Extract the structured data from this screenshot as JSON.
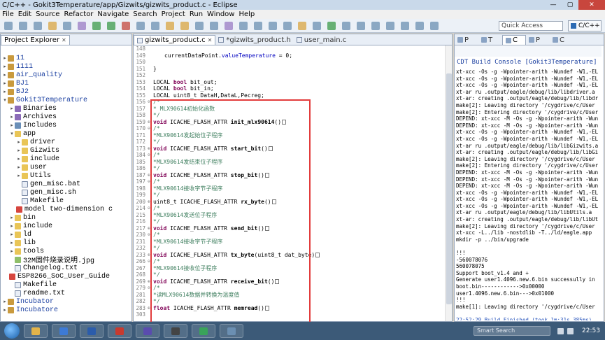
{
  "window": {
    "title": "C/C++ - Gokit3Temperature/app/Gizwits/gizwits_product.c - Eclipse"
  },
  "menu": [
    "File",
    "Edit",
    "Source",
    "Refactor",
    "Navigate",
    "Search",
    "Project",
    "Run",
    "Window",
    "Help"
  ],
  "toolbar": {
    "quick_access_placeholder": "Quick Access",
    "perspective": "C/C++"
  },
  "project_explorer": {
    "tab_label": "Project Explorer",
    "items": [
      {
        "depth": 0,
        "arrow": "▸",
        "icon": "project",
        "label": "11"
      },
      {
        "depth": 0,
        "arrow": "▸",
        "icon": "project",
        "label": "1111"
      },
      {
        "depth": 0,
        "arrow": "▸",
        "icon": "project",
        "label": "air_quality"
      },
      {
        "depth": 0,
        "arrow": "▸",
        "icon": "project",
        "label": "BJ1"
      },
      {
        "depth": 0,
        "arrow": "▸",
        "icon": "project",
        "label": "BJ2"
      },
      {
        "depth": 0,
        "arrow": "▾",
        "icon": "project",
        "label": "Gokit3Temperature"
      },
      {
        "depth": 1,
        "arrow": "▸",
        "icon": "bin",
        "label": "Binaries"
      },
      {
        "depth": 1,
        "arrow": "▸",
        "icon": "bin",
        "label": "Archives"
      },
      {
        "depth": 1,
        "arrow": "▸",
        "icon": "inc",
        "label": "Includes"
      },
      {
        "depth": 1,
        "arrow": "▾",
        "icon": "folder",
        "label": "app"
      },
      {
        "depth": 2,
        "arrow": "▸",
        "icon": "folder",
        "label": "driver"
      },
      {
        "depth": 2,
        "arrow": "▸",
        "icon": "folder",
        "label": "Gizwits"
      },
      {
        "depth": 2,
        "arrow": "▸",
        "icon": "folder",
        "label": "include"
      },
      {
        "depth": 2,
        "arrow": "▸",
        "icon": "folder",
        "label": "user"
      },
      {
        "depth": 2,
        "arrow": "▸",
        "icon": "folder",
        "label": "Utils"
      },
      {
        "depth": 2,
        "arrow": "",
        "icon": "file",
        "label": "gen_misc.bat"
      },
      {
        "depth": 2,
        "arrow": "",
        "icon": "file",
        "label": "gen_misc.sh"
      },
      {
        "depth": 2,
        "arrow": "",
        "icon": "file",
        "label": "Makefile"
      },
      {
        "depth": 2,
        "arrow": "",
        "icon": "pdf",
        "label": "model two-dimension code"
      },
      {
        "depth": 1,
        "arrow": "▸",
        "icon": "folder",
        "label": "bin"
      },
      {
        "depth": 1,
        "arrow": "▸",
        "icon": "folder",
        "label": "include"
      },
      {
        "depth": 1,
        "arrow": "▸",
        "icon": "folder",
        "label": "ld"
      },
      {
        "depth": 1,
        "arrow": "▸",
        "icon": "folder",
        "label": "lib"
      },
      {
        "depth": 1,
        "arrow": "▸",
        "icon": "folder",
        "label": "tools"
      },
      {
        "depth": 1,
        "arrow": "",
        "icon": "image",
        "label": "32M固件烧录说明.jpg"
      },
      {
        "depth": 1,
        "arrow": "",
        "icon": "file",
        "label": "Changelog.txt"
      },
      {
        "depth": 1,
        "arrow": "",
        "icon": "pdf",
        "label": "ESP8266_SoC_User_Guide _V0"
      },
      {
        "depth": 1,
        "arrow": "",
        "icon": "file",
        "label": "Makefile"
      },
      {
        "depth": 1,
        "arrow": "",
        "icon": "file",
        "label": "readme.txt"
      },
      {
        "depth": 0,
        "arrow": "▸",
        "icon": "project",
        "label": "Incubator"
      },
      {
        "depth": 0,
        "arrow": "▸",
        "icon": "project",
        "label": "Incubatore"
      }
    ]
  },
  "editor": {
    "tabs": [
      {
        "label": "gizwits_product.c",
        "active": true
      },
      {
        "label": "*gizwits_product.h",
        "active": false
      },
      {
        "label": "user_main.c",
        "active": false
      }
    ],
    "lines": [
      {
        "n": "148",
        "fold": "",
        "html": "<span style=\"padding-left:16px\"></span>"
      },
      {
        "n": "149",
        "fold": "",
        "html": "<span style=\"padding-left:16px\">currentDataPoint.</span><span class=\"field\">valueTemperature</span> = 0;"
      },
      {
        "n": "150",
        "fold": "",
        "html": ""
      },
      {
        "n": "151",
        "fold": "",
        "html": "}"
      },
      {
        "n": "152",
        "fold": "",
        "html": ""
      },
      {
        "n": "153",
        "fold": "",
        "html": "LOCAL <span class=\"kw\">bool</span> bit_out;"
      },
      {
        "n": "154",
        "fold": "",
        "html": "LOCAL <span class=\"kw\">bool</span> bit_in;"
      },
      {
        "n": "155",
        "fold": "",
        "html": "LOCAL uint8_t DataH,DataL,Pecreg;"
      },
      {
        "n": "156",
        "fold": "⊖",
        "html": "<span class=\"cm\">/*</span>"
      },
      {
        "n": "157",
        "fold": "",
        "html": "<span class=\"cm\"> * MLX90614初始化函数</span>"
      },
      {
        "n": "158",
        "fold": "",
        "html": "<span class=\"cm\"> */</span>"
      },
      {
        "n": "159",
        "fold": "⊕",
        "html": "<span class=\"kw\">void</span> ICACHE_FLASH_ATTR <span class=\"fn\">init_mlx90614</span>()<span class=\"folded-box\"></span>"
      },
      {
        "n": "170",
        "fold": "⊖",
        "html": "<span class=\"cm\">/*</span>"
      },
      {
        "n": "171",
        "fold": "",
        "html": "<span class=\"cm\"> *MLX90614发起始位子程序</span>"
      },
      {
        "n": "172",
        "fold": "",
        "html": "<span class=\"cm\"> */</span>"
      },
      {
        "n": "173",
        "fold": "⊕",
        "html": "<span class=\"kw\">void</span> ICACHE_FLASH_ATTR <span class=\"fn\">start_bit</span>()<span class=\"folded-box\"></span>"
      },
      {
        "n": "184",
        "fold": "⊖",
        "html": "<span class=\"cm\">/*</span>"
      },
      {
        "n": "185",
        "fold": "",
        "html": "<span class=\"cm\"> *MLX90614发结束位子程序</span>"
      },
      {
        "n": "186",
        "fold": "",
        "html": "<span class=\"cm\"> */</span>"
      },
      {
        "n": "187",
        "fold": "⊕",
        "html": "<span class=\"kw\">void</span> ICACHE_FLASH_ATTR <span class=\"fn\">stop_bit</span>()<span class=\"folded-box\"></span>"
      },
      {
        "n": "197",
        "fold": "⊖",
        "html": "<span class=\"cm\">/*</span>"
      },
      {
        "n": "198",
        "fold": "",
        "html": "<span class=\"cm\"> *MLX90614接收字节子程序</span>"
      },
      {
        "n": "199",
        "fold": "",
        "html": "<span class=\"cm\"> */</span>"
      },
      {
        "n": "200",
        "fold": "⊕",
        "html": "uint8_t ICACHE_FLASH_ATTR <span class=\"fn\">rx_byte</span>()<span class=\"folded-box\"></span>"
      },
      {
        "n": "214",
        "fold": "⊖",
        "html": "<span class=\"cm\">/*</span>"
      },
      {
        "n": "215",
        "fold": "",
        "html": "<span class=\"cm\"> *MLX90614发送位子程序</span>"
      },
      {
        "n": "216",
        "fold": "",
        "html": "<span class=\"cm\"> */</span>"
      },
      {
        "n": "217",
        "fold": "⊕",
        "html": "<span class=\"kw\">void</span> ICACHE_FLASH_ATTR <span class=\"fn\">send_bit</span>()<span class=\"folded-box\"></span>"
      },
      {
        "n": "230",
        "fold": "⊖",
        "html": "<span class=\"cm\">/*</span>"
      },
      {
        "n": "231",
        "fold": "",
        "html": "<span class=\"cm\"> *MLX90614接收字节子程序</span>"
      },
      {
        "n": "232",
        "fold": "",
        "html": "<span class=\"cm\"> */</span>"
      },
      {
        "n": "233",
        "fold": "⊕",
        "html": "<span class=\"kw\">void</span> ICACHE_FLASH_ATTR <span class=\"fn\">tx_byte</span>(uint8_t dat_byte)<span class=\"folded-box\"></span>"
      },
      {
        "n": "266",
        "fold": "⊖",
        "html": "<span class=\"cm\">/*</span>"
      },
      {
        "n": "267",
        "fold": "",
        "html": "<span class=\"cm\"> *MLX90614接收位子程序</span>"
      },
      {
        "n": "268",
        "fold": "",
        "html": "<span class=\"cm\"> */</span>"
      },
      {
        "n": "269",
        "fold": "⊕",
        "html": "<span class=\"kw\">void</span> ICACHE_FLASH_ATTR <span class=\"fn\">receive_bit</span>()<span class=\"folded-box\"></span>"
      },
      {
        "n": "279",
        "fold": "⊖",
        "html": "<span class=\"cm\">/*</span>"
      },
      {
        "n": "281",
        "fold": "",
        "html": "<span class=\"cm\"> *读MLX90614数据并转换为温度值</span>"
      },
      {
        "n": "282",
        "fold": "",
        "html": "<span class=\"cm\"> */</span>"
      },
      {
        "n": "283",
        "fold": "⊕",
        "html": "<span class=\"kw\">float</span> ICACHE_FLASH_ATTR <span class=\"fn\">memread</span>()<span class=\"folded-box\"></span>"
      },
      {
        "n": "303",
        "fold": "",
        "html": ""
      }
    ]
  },
  "console": {
    "tabs": [
      "P",
      "T",
      "C",
      "P",
      "C"
    ],
    "title": "CDT Build Console [Gokit3Temperature]",
    "lines": [
      {
        "text": "xt-xcc -Os -g -Wpointer-arith -Wundef -W1,-EL",
        "blue": false
      },
      {
        "text": "xt-xcc -Os -g -Wpointer-arith -Wundef -W1,-EL",
        "blue": false
      },
      {
        "text": "xt-xcc -Os -g -Wpointer-arith -Wundef -W1,-EL",
        "blue": false
      },
      {
        "text": "xt-ar ru .output/eagle/debug/lib/libdriver.a",
        "blue": false
      },
      {
        "text": "xt-ar: creating .output/eagle/debug/lib/libdr",
        "blue": false
      },
      {
        "text": "make[2]: Leaving directory '/cygdrive/c/User",
        "blue": false
      },
      {
        "text": "make[2]: Entering directory '/cygdrive/c/User",
        "blue": false
      },
      {
        "text": "DEPEND: xt-xcc -M -Os -g -Wpointer-arith -Wun",
        "blue": false
      },
      {
        "text": "DEPEND: xt-xcc -M -Os -g -Wpointer-arith -Wun",
        "blue": false
      },
      {
        "text": "xt-xcc -Os -g -Wpointer-arith -Wundef -W1,-EL",
        "blue": false
      },
      {
        "text": "xt-xcc -Os -g -Wpointer-arith -Wundef -W1,-EL",
        "blue": false
      },
      {
        "text": "xt-ar ru .output/eagle/debug/lib/libGizwits.a",
        "blue": false
      },
      {
        "text": "xt-ar: creating .output/eagle/debug/lib/libGi",
        "blue": false
      },
      {
        "text": "make[2]: Leaving directory '/cygdrive/c/User",
        "blue": false
      },
      {
        "text": "make[2]: Entering directory '/cygdrive/c/User",
        "blue": false
      },
      {
        "text": "DEPEND: xt-xcc -M -Os -g -Wpointer-arith -Wun",
        "blue": false
      },
      {
        "text": "DEPEND: xt-xcc -M -Os -g -Wpointer-arith -Wun",
        "blue": false
      },
      {
        "text": "DEPEND: xt-xcc -M -Os -g -Wpointer-arith -Wun",
        "blue": false
      },
      {
        "text": "xt-xcc -Os -g -Wpointer-arith -Wundef -W1,-EL",
        "blue": false
      },
      {
        "text": "xt-xcc -Os -g -Wpointer-arith -Wundef -W1,-EL",
        "blue": false
      },
      {
        "text": "xt-xcc -Os -g -Wpointer-arith -Wundef -W1,-EL",
        "blue": false
      },
      {
        "text": "xt-ar ru .output/eagle/debug/lib/libUtils.a",
        "blue": false
      },
      {
        "text": "xt-ar: creating .output/eagle/debug/lib/libUt",
        "blue": false
      },
      {
        "text": "make[2]: Leaving directory '/cygdrive/c/User",
        "blue": false
      },
      {
        "text": "xt-xcc  -L../lib -nostdlib -T../ld/eagle.app",
        "blue": false
      },
      {
        "text": "mkdir -p ../bin/upgrade",
        "blue": false
      },
      {
        "text": "",
        "blue": false
      },
      {
        "text": "!!!",
        "blue": false
      },
      {
        "text": "-560078076",
        "blue": false
      },
      {
        "text": "560078075",
        "blue": false
      },
      {
        "text": "Support boot_v1.4 and +",
        "blue": false
      },
      {
        "text": "Generate user1.4096.new.6.bin successully in",
        "blue": false
      },
      {
        "text": "boot.bin------------>0x00000",
        "blue": false
      },
      {
        "text": "user1.4096.new.6.bin--->0x01000",
        "blue": false
      },
      {
        "text": "!!!",
        "blue": false
      },
      {
        "text": "make[1]: Leaving directory '/cygdrive/c/User",
        "blue": false
      },
      {
        "text": "",
        "blue": false
      },
      {
        "text": "22:52:29 Build Finished (took 1m:31s.385ms)",
        "blue": true
      }
    ]
  },
  "taskbar": {
    "search_placeholder": "Smart Search",
    "clock": "22:53",
    "apps": [
      {
        "name": "file-explorer",
        "color": "#e2b34a"
      },
      {
        "name": "media-player",
        "color": "#3d7ad6"
      },
      {
        "name": "word",
        "color": "#2b5cab"
      },
      {
        "name": "wps",
        "color": "#c83a2f"
      },
      {
        "name": "eclipse",
        "color": "#5a4cae"
      },
      {
        "name": "terminal",
        "color": "#444444"
      },
      {
        "name": "chrome",
        "color": "#3aa35a"
      },
      {
        "name": "network-tool",
        "color": "#6b8fb2"
      }
    ]
  }
}
